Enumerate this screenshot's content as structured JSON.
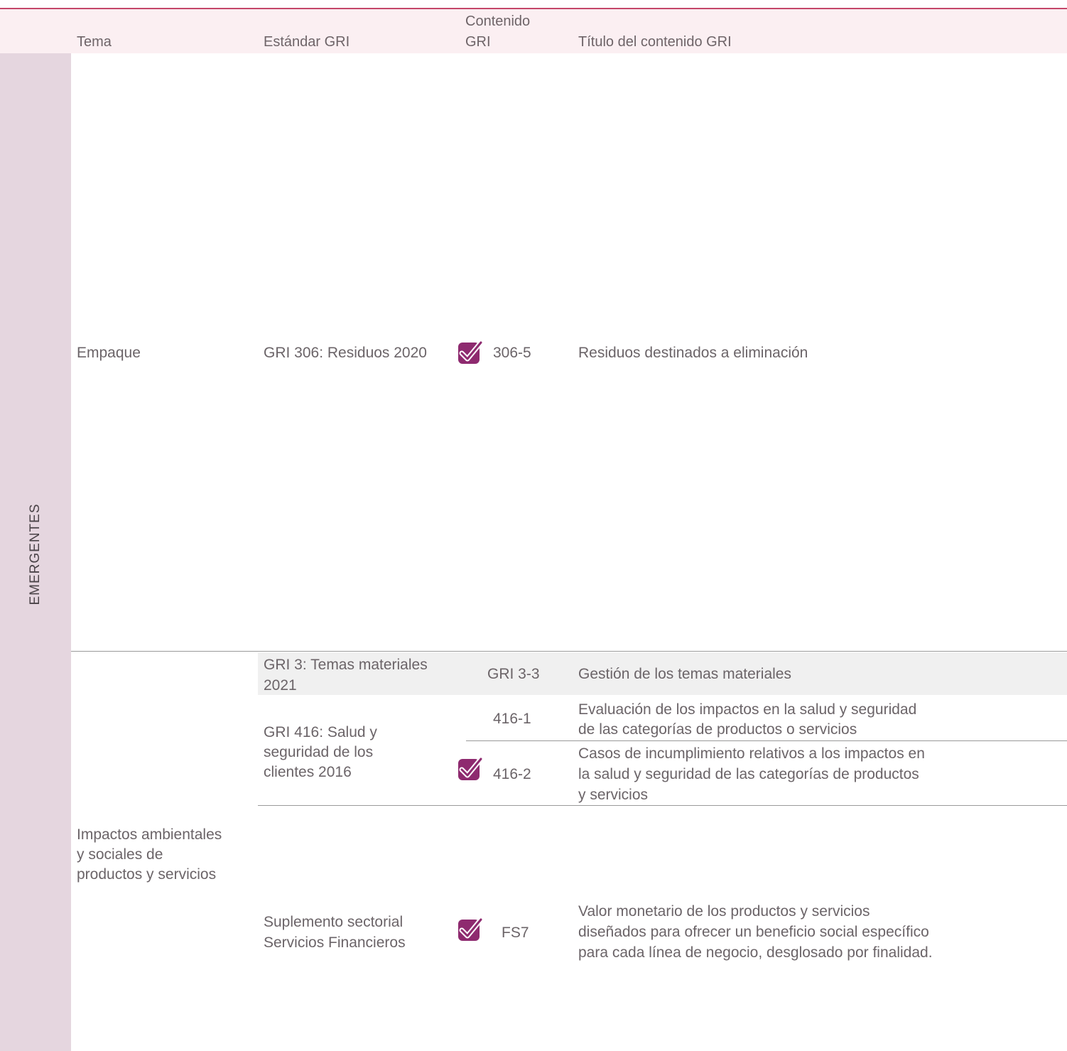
{
  "header": {
    "tema": "Tema",
    "estandar": "Estándar GRI",
    "contenido_line1": "Contenido",
    "contenido_line2": "GRI",
    "titulo": "Título del contenido GRI"
  },
  "sidebar": {
    "category": "EMERGENTES"
  },
  "rows": {
    "empaque": {
      "tema": "Empaque",
      "estandar": "GRI 306: Residuos 2020",
      "code": "306-5",
      "title": "Residuos destinados a eliminación"
    },
    "impactos": {
      "tema_line1": "Impactos ambientales",
      "tema_line2": "y sociales de",
      "tema_line3": "productos y servicios",
      "gri3": {
        "estandar_line1": "GRI 3: Temas materiales",
        "estandar_line2": "2021",
        "code": "GRI 3-3",
        "title": "Gestión de los temas materiales"
      },
      "gri416": {
        "estandar_line1": "GRI 416: Salud y",
        "estandar_line2": "seguridad de los",
        "estandar_line3": "clientes 2016",
        "row1": {
          "code": "416-1",
          "title_line1": "Evaluación de los impactos en la salud y seguridad",
          "title_line2": "de las categorías de productos o servicios"
        },
        "row2": {
          "code": "416-2",
          "title_line1": "Casos de incumplimiento relativos a los impactos en",
          "title_line2": "la salud y seguridad de las categorías de productos",
          "title_line3": "y servicios"
        }
      },
      "fs": {
        "estandar_line1": "Suplemento sectorial",
        "estandar_line2": "Servicios Financieros",
        "code": "FS7",
        "title_line1": "Valor monetario de los productos y servicios",
        "title_line2": "diseñados para ofrecer un beneficio social específico",
        "title_line3": "para cada línea de negocio, desglosado por finalidad."
      }
    }
  },
  "colors": {
    "accent": "#c5476a",
    "header_bg": "#fbeff2",
    "sidebar_bg": "#e5d6df",
    "check_purple": "#8e2a6f",
    "text": "#6b6468"
  },
  "icons": {
    "check": "checkmark-badge-icon"
  }
}
